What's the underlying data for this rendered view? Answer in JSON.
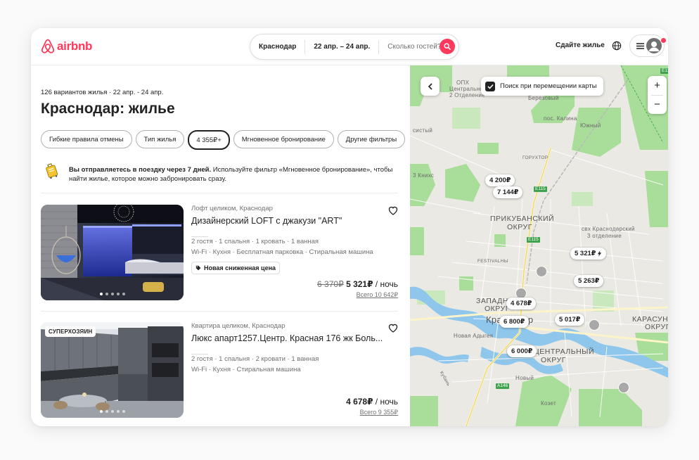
{
  "header": {
    "logo_text": "airbnb",
    "search": {
      "location": "Краснодар",
      "dates": "22 апр. – 24 апр.",
      "guests_placeholder": "Сколько гостей?"
    },
    "host_link": "Сдайте жилье",
    "brand_color": "#ff385c"
  },
  "results": {
    "meta": "126 вариантов жилья · 22 апр. - 24 апр.",
    "title": "Краснодар: жилье",
    "filters": [
      "Гибкие правила отмены",
      "Тип жилья",
      "4 355₽+",
      "Мгновенное бронирование",
      "Другие фильтры"
    ],
    "active_filter": "4 355₽+",
    "notice": {
      "bold": "Вы отправляетесь в поездку через 7 дней.",
      "text": " Используйте фильтр «Мгновенное бронирование», чтобы найти жилье, которое можно забронировать сразу."
    }
  },
  "listings": [
    {
      "subtitle": "Лофт целиком, Краснодар",
      "title": "Дизайнерский LOFT с джакузи \"ART\"",
      "details": "2 гостя · 1 спальня · 1 кровать · 1 ванная",
      "amenities": "Wi-Fi · Кухня · Бесплатная парковка · Стиральная машина",
      "tag": "Новая сниженная цена",
      "price_old": "6 370₽",
      "price": "5 321₽",
      "per": " / ночь",
      "total": "Всего 10 642₽"
    },
    {
      "badge": "СУПЕРХОЗЯИН",
      "subtitle": "Квартира целиком, Краснодар",
      "title": "Люкс апарт1257.Центр. Красная 176 жк Боль...",
      "details": "2 гостя · 1 спальня · 2 кровати · 1 ванная",
      "amenities": "Wi-Fi · Кухня · Стиральная машина",
      "price": "4 678₽",
      "per": " / ночь",
      "total": "Всего 9 355₽"
    }
  ],
  "map": {
    "toggle_label": "Поиск при перемещении карты",
    "zoom_in": "+",
    "zoom_out": "−",
    "labels": {
      "opx": "ОПХ",
      "central": "Центральное",
      "dept2": "2 Отделение",
      "berezovy": "Березовый",
      "kalina": "пос. Калина",
      "yuzhny": "Южный",
      "sisty": "систый",
      "goryator": "ГОРУХТОР",
      "knihs": "3 Книхс",
      "prikuban": "ПРИКУБАНСКИЙ",
      "okrug": "ОКРУГ",
      "svh": "свх Краснодарский",
      "dept3": "3 отделение",
      "festival": "FESTIVALНЫ",
      "zapad": "ЗАПАДНЫЙ",
      "zapad2": "ОКРУГ",
      "krasnodar": "Краснодар",
      "karasun": "КАРАСУН",
      "karasun2": "ОКРУГ",
      "nova_adyg": "Новая Адыгея",
      "central_okrug": "ЦЕНТРАЛЬНЫЙ",
      "central_okrug2": "ОКРУГ",
      "novy": "Новый",
      "kozet": "Козет",
      "kuban": "Кубань"
    },
    "pins": [
      "4 200₽",
      "7 144₽",
      "5 321₽",
      "5 263₽",
      "4 678₽",
      "6 800₽",
      "5 017₽",
      "6 000₽"
    ],
    "roads": [
      "E115",
      "E115",
      "E115",
      "A146"
    ]
  }
}
